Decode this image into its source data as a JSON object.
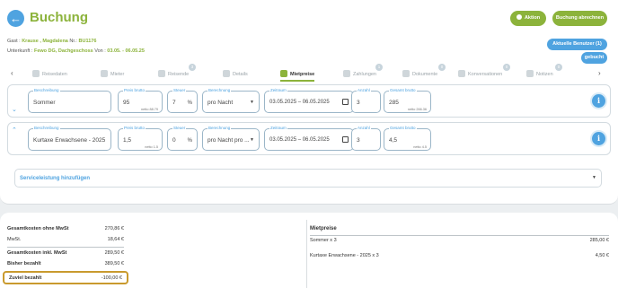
{
  "header": {
    "title": "Buchung",
    "aktion_label": "Aktion",
    "abrechnen_label": "Buchung abrechnen",
    "benutzer_label": "Aktuelle Benutzer (1)",
    "status_label": "gebucht"
  },
  "guest": {
    "gast_prefix": "Gast : ",
    "gast_name": "Krause , Magdalena",
    "nr_prefix": " Nr.: ",
    "nr_value": "BU1176",
    "unterkunft_prefix": "Unterkunft : ",
    "unterkunft_value": "Fewo DG, Dachgeschoss",
    "von_prefix": " Von : ",
    "von_value": "03.05. - 06.05.25"
  },
  "tabs": [
    {
      "label": "Reisedaten",
      "badge": ""
    },
    {
      "label": "Mieter",
      "badge": ""
    },
    {
      "label": "Reisende",
      "badge": "3"
    },
    {
      "label": "Details",
      "badge": ""
    },
    {
      "label": "Mietpreise",
      "badge": ""
    },
    {
      "label": "Zahlungen",
      "badge": "1"
    },
    {
      "label": "Dokumente",
      "badge": "0"
    },
    {
      "label": "Konversationen",
      "badge": "0"
    },
    {
      "label": "Notizen",
      "badge": "0"
    }
  ],
  "price_rows": [
    {
      "beschreibung_label": "Beschreibung",
      "beschreibung": "Sommer",
      "preis_label": "Preis brutto",
      "preis": "95",
      "preis_netto": "netto 88.79",
      "steuer_label": "Steuer",
      "steuer": "7",
      "steuer_unit": "%",
      "berechnung_label": "Berechnung",
      "berechnung": "pro Nacht",
      "zeitraum_label": "Zeitraum",
      "zeitraum": "03.05.2025 – 06.05.2025",
      "anzahl_label": "Anzahl",
      "anzahl": "3",
      "gesamt_label": "Gesamt brutto",
      "gesamt": "285",
      "gesamt_netto": "netto 266.36"
    },
    {
      "beschreibung_label": "Beschreibung",
      "beschreibung": "Kurtaxe Erwachsene - 2025",
      "preis_label": "Preis brutto",
      "preis": "1,5",
      "preis_netto": "netto 1.5",
      "steuer_label": "Steuer",
      "steuer": "0",
      "steuer_unit": "%",
      "berechnung_label": "Berechnung",
      "berechnung": "pro Nacht pro ...",
      "zeitraum_label": "Zeitraum",
      "zeitraum": "03.05.2025 – 06.05.2025",
      "anzahl_label": "Anzahl",
      "anzahl": "3",
      "gesamt_label": "Gesamt brutto",
      "gesamt": "4,5",
      "gesamt_netto": "netto 4.5"
    }
  ],
  "service": {
    "label": "Serviceleistung hinzufügen"
  },
  "summary": {
    "rows": [
      {
        "label": "Gesamtkosten ohne MwSt",
        "value": "270,86 €"
      },
      {
        "label": "MwSt.",
        "value": "18,64 €"
      },
      {
        "label": "Gesamtkosten inkl. MwSt",
        "value": "289,50 €"
      },
      {
        "label": "Bisher bezahlt",
        "value": "389,50 €"
      }
    ],
    "zuviel_label": "Zuviel bezahlt",
    "zuviel_value": "-100,00 €"
  },
  "mietpreise": {
    "heading": "Mietpreise",
    "items": [
      {
        "label": "Sommer x 3",
        "value": "285,00 €"
      },
      {
        "label": "Kurtaxe Erwachsene - 2025 x 3",
        "value": "4,50 €"
      }
    ]
  },
  "colors": {
    "brand_green": "#8cb33b",
    "accent_blue": "#4fa3e0",
    "highlight": "#c99a2e"
  }
}
